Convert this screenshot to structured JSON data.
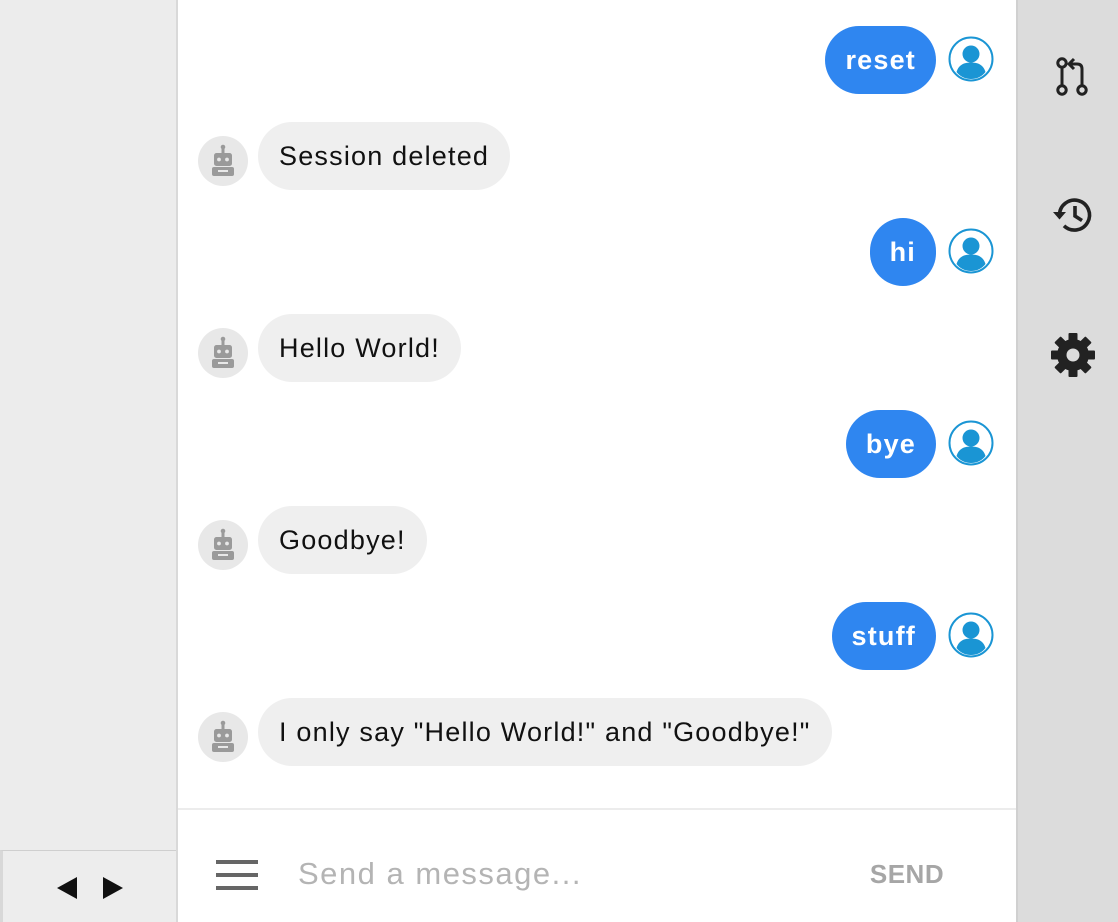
{
  "left_panel": {
    "pager": {
      "prev_icon": "triangle-left-icon",
      "next_icon": "triangle-right-icon"
    }
  },
  "chat": {
    "messages": [
      {
        "sender": "user",
        "text": "reset"
      },
      {
        "sender": "bot",
        "text": "Session deleted"
      },
      {
        "sender": "user",
        "text": "hi"
      },
      {
        "sender": "bot",
        "text": "Hello World!"
      },
      {
        "sender": "user",
        "text": "bye"
      },
      {
        "sender": "bot",
        "text": "Goodbye!"
      },
      {
        "sender": "user",
        "text": "stuff"
      },
      {
        "sender": "bot",
        "text": "I only say \"Hello World!\" and \"Goodbye!\""
      }
    ],
    "user_avatar_icon": "user-avatar-icon",
    "bot_avatar_icon": "robot-icon"
  },
  "composer": {
    "menu_icon": "hamburger-menu-icon",
    "input_value": "",
    "input_placeholder": "Send a message...",
    "send_label": "SEND"
  },
  "toolbar": {
    "icons": [
      "pull-request-icon",
      "history-icon",
      "gear-icon"
    ]
  },
  "colors": {
    "user_bubble": "#2f86f0",
    "bot_bubble": "#efefef",
    "user_avatar": "#1a95d4",
    "bot_avatar": "#9a9a9a",
    "toolbar_bg": "#dcdcdc"
  }
}
